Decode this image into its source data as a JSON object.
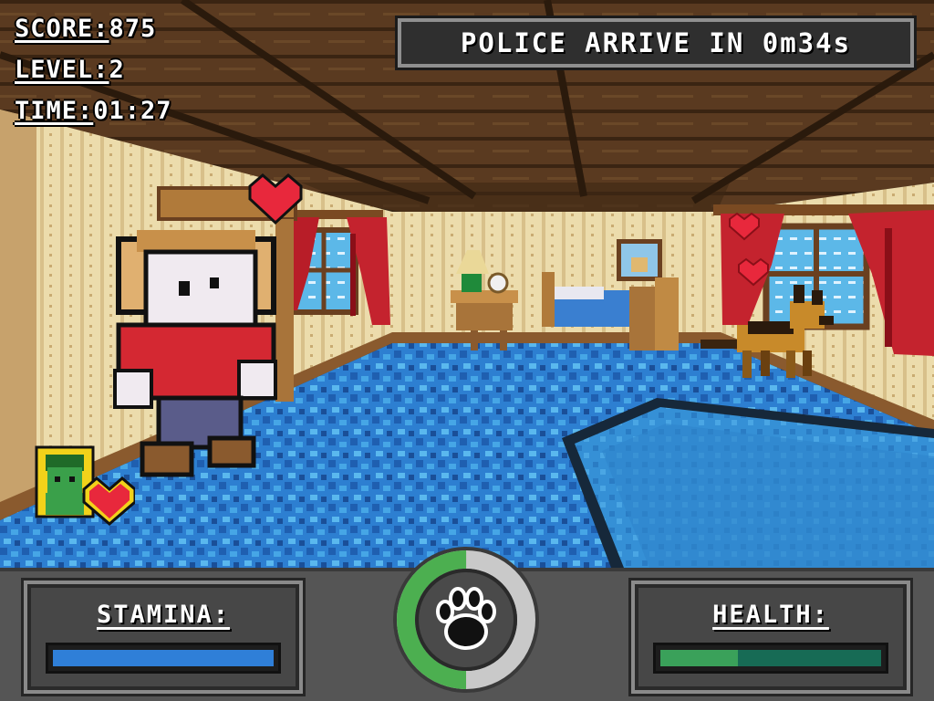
{
  "hud": {
    "score_label": "SCORE:",
    "score_value": "875",
    "level_label": "LEVEL:",
    "level_value": "2",
    "time_label": "TIME:",
    "time_value": "01:27"
  },
  "police_banner": "POLICE ARRIVE IN 0m34s",
  "stamina": {
    "label": "STAMINA:",
    "fraction": 1.0,
    "color": "#2f7fd8"
  },
  "health": {
    "label": "HEALTH:",
    "fraction": 0.35,
    "color": "#3aa15a",
    "empty_color": "#176b55"
  },
  "ability_gauge": {
    "icon": "paw-icon",
    "fraction": 0.5,
    "fill_color": "#4caf50",
    "track_color": "#c9c9c9"
  },
  "companion": {
    "icon": "goblin-portrait-icon",
    "status_icon": "heart-icon"
  },
  "colors": {
    "carpet": "#2a7fd0",
    "wall": "#e8d8a8",
    "curtain": "#c0202a",
    "heart": "#e8283c"
  }
}
